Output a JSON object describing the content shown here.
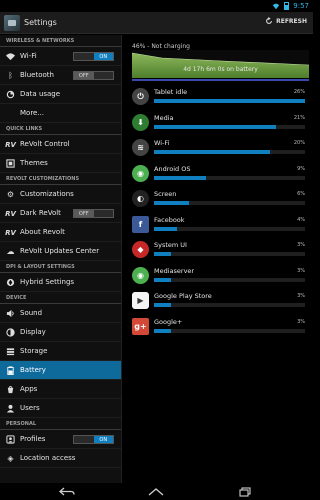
{
  "status_bar": {
    "time": "9:57"
  },
  "action_bar": {
    "title": "Settings",
    "refresh_label": "REFRESH"
  },
  "sidebar": {
    "sections": [
      {
        "header": "WIRELESS & NETWORKS"
      },
      {
        "header": "QUICK LINKS"
      },
      {
        "header": "REVOLT CUSTOMIZATIONS"
      },
      {
        "header": "DPI & LAYOUT SETTINGS"
      },
      {
        "header": "DEVICE"
      },
      {
        "header": "PERSONAL"
      }
    ],
    "items": [
      {
        "label": "Wi-Fi",
        "icon": "wifi-icon",
        "toggle_on": "ON",
        "toggle_off": ""
      },
      {
        "label": "Bluetooth",
        "icon": "bluetooth-icon",
        "toggle_on": "",
        "toggle_off": "OFF"
      },
      {
        "label": "Data usage",
        "icon": "data-usage-icon"
      },
      {
        "label": "More...",
        "icon": ""
      },
      {
        "label": "ReVolt Control",
        "icon": "revolt-icon"
      },
      {
        "label": "Themes",
        "icon": "themes-icon"
      },
      {
        "label": "Customizations",
        "icon": "gear-icon"
      },
      {
        "label": "Dark ReVolt",
        "icon": "revolt-icon",
        "toggle_on": "",
        "toggle_off": "OFF"
      },
      {
        "label": "About Revolt",
        "icon": "revolt-icon"
      },
      {
        "label": "ReVolt Updates Center",
        "icon": "cloud-icon"
      },
      {
        "label": "Hybrid Settings",
        "icon": "hybrid-icon"
      },
      {
        "label": "Sound",
        "icon": "speaker-icon"
      },
      {
        "label": "Display",
        "icon": "display-icon"
      },
      {
        "label": "Storage",
        "icon": "storage-icon"
      },
      {
        "label": "Battery",
        "icon": "battery-icon"
      },
      {
        "label": "Apps",
        "icon": "apps-icon"
      },
      {
        "label": "Users",
        "icon": "users-icon"
      },
      {
        "label": "Profiles",
        "icon": "profiles-icon",
        "toggle_on": "ON",
        "toggle_off": ""
      },
      {
        "label": "Location access",
        "icon": "location-icon"
      }
    ]
  },
  "battery": {
    "status": "46% - Not charging",
    "time_on_battery": "4d 17h 6m 0s on battery",
    "level_percent": 46
  },
  "usage": [
    {
      "name": "Tablet idle",
      "percent": "26%",
      "value": 26,
      "icon": "power-icon",
      "color": "#444444"
    },
    {
      "name": "Media",
      "percent": "21%",
      "value": 21,
      "icon": "media-download-icon",
      "color": "#2e7d32"
    },
    {
      "name": "Wi-Fi",
      "percent": "20%",
      "value": 20,
      "icon": "wifi-icon",
      "color": "#444444"
    },
    {
      "name": "Android OS",
      "percent": "9%",
      "value": 9,
      "icon": "android-icon",
      "color": "#4caf50"
    },
    {
      "name": "Screen",
      "percent": "6%",
      "value": 6,
      "icon": "brightness-icon",
      "color": "#222222"
    },
    {
      "name": "Facebook",
      "percent": "4%",
      "value": 4,
      "icon": "facebook-icon",
      "color": "#3b5998"
    },
    {
      "name": "System UI",
      "percent": "3%",
      "value": 3,
      "icon": "android-icon",
      "color": "#c62828"
    },
    {
      "name": "Mediaserver",
      "percent": "3%",
      "value": 3,
      "icon": "android-icon",
      "color": "#4caf50"
    },
    {
      "name": "Google Play Store",
      "percent": "3%",
      "value": 3,
      "icon": "play-store-icon",
      "color": "#f5f5f5"
    },
    {
      "name": "Google+",
      "percent": "3%",
      "value": 3,
      "icon": "google-plus-icon",
      "color": "#d34836"
    }
  ],
  "usage_glyphs": [
    "⏻",
    "⬇",
    "≋",
    "◉",
    "◐",
    "f",
    "◆",
    "◉",
    "▶",
    "g+"
  ]
}
